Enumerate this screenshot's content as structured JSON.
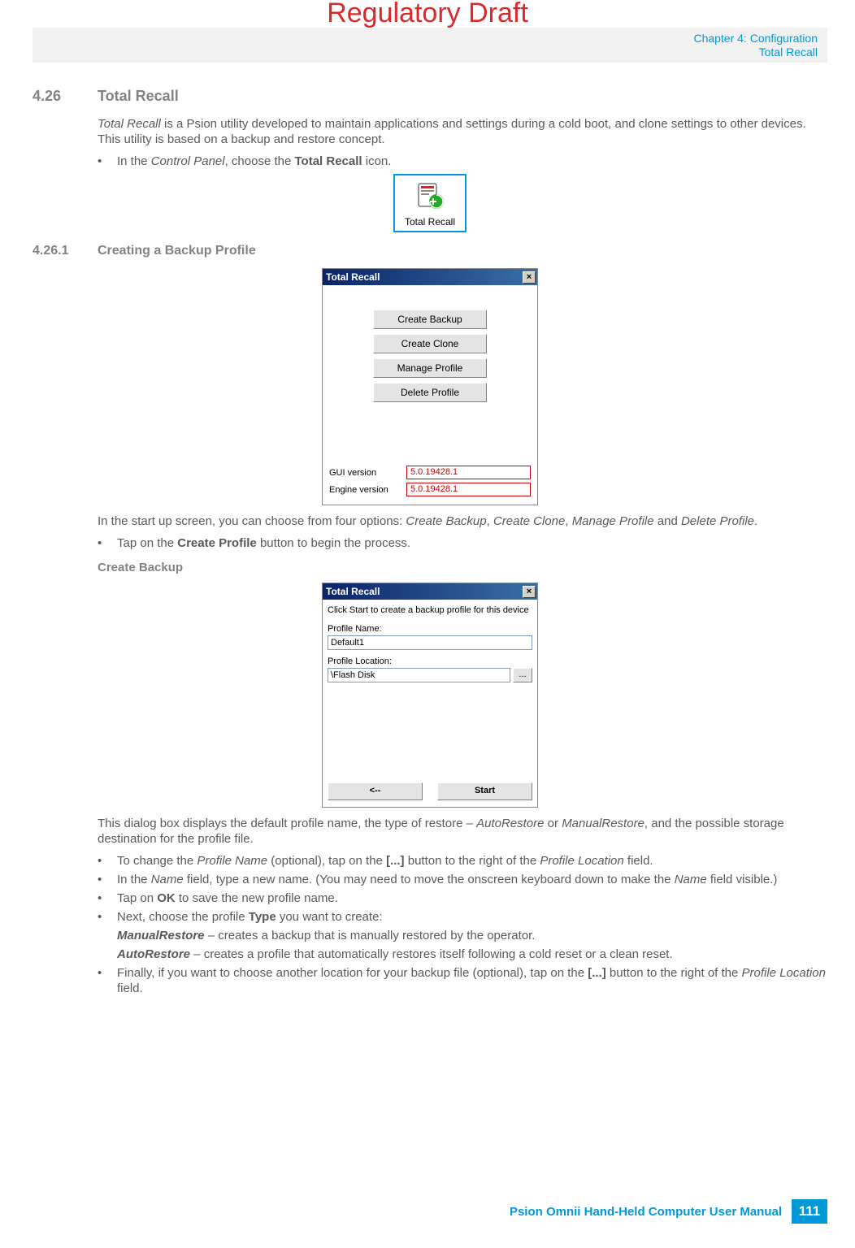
{
  "watermark": "Regulatory Draft",
  "header": {
    "chapter": "Chapter 4:  Configuration",
    "section": "Total Recall"
  },
  "s426": {
    "num": "4.26",
    "title": "Total Recall",
    "intro_a": "Total Recall",
    "intro_b": " is a Psion utility developed to maintain applications and settings during a cold boot, and clone settings to other devices. This utility is based on a backup and restore concept.",
    "b1a": "In the ",
    "b1b": "Control Panel",
    "b1c": ", choose the ",
    "b1d": "Total Recall",
    "b1e": " icon."
  },
  "iconfig": {
    "label": "Total Recall"
  },
  "s4261": {
    "num": "4.26.1",
    "title": "Creating a Backup Profile"
  },
  "dialog1": {
    "title": "Total Recall",
    "btn1": "Create Backup",
    "btn2": "Create Clone",
    "btn3": "Manage Profile",
    "btn4": "Delete Profile",
    "gui_lab": "GUI version",
    "gui_val": "5.0.19428.1",
    "eng_lab": "Engine version",
    "eng_val": "5.0.19428.1"
  },
  "afterD1": {
    "p1a": "In the start up screen, you can choose from four options: ",
    "p1b": "Create Backup",
    "p1c": ", ",
    "p1d": "Create Clone",
    "p1e": ", ",
    "p1f": "Manage Profile",
    "p1g": " and ",
    "p1h": "Delete Profile",
    "p1i": ".",
    "b1a": "Tap on the ",
    "b1b": "Create Profile",
    "b1c": " button to begin the process."
  },
  "createBackupHead": "Create Backup",
  "dialog2": {
    "title": "Total Recall",
    "msg": "Click Start to create a backup profile for this device",
    "pname_lab": "Profile Name:",
    "pname_val": "Default1",
    "ploc_lab": "Profile Location:",
    "ploc_val": "\\Flash Disk",
    "browse": "...",
    "back": "<--",
    "start": "Start"
  },
  "afterD2": {
    "p1a": "This dialog box displays the default profile name, the type of restore – ",
    "p1b": "AutoRestore",
    "p1c": " or ",
    "p1d": "ManualRestore",
    "p1e": ", and the possible storage destination for the profile file.",
    "b1a": "To change the ",
    "b1b": "Profile Name",
    "b1c": " (optional), tap on the ",
    "b1d": "[...]",
    "b1e": " button to the right of the ",
    "b1f": "Profile Location",
    "b1g": " field.",
    "b2a": "In the ",
    "b2b": "Name",
    "b2c": " field, type a new name. (You may need to move the onscreen keyboard down to make the ",
    "b2d": "Name",
    "b2e": " field visible.)",
    "b3a": "Tap on ",
    "b3b": "OK",
    "b3c": " to save the new profile name.",
    "b4a": "Next, choose the profile ",
    "b4b": "Type",
    "b4c": " you want to create:",
    "ind1a": "ManualRestore",
    "ind1b": " – creates a backup that is manually restored by the operator.",
    "ind2a": "AutoRestore",
    "ind2b": " – creates a profile that automatically restores itself following a cold reset or a clean reset.",
    "b5a": "Finally, if you want to choose another location for your backup file (optional), tap on the ",
    "b5b": "[...]",
    "b5c": " button to the right of the ",
    "b5d": "Profile Location",
    "b5e": " field."
  },
  "footer": {
    "text": "Psion Omnii Hand-Held Computer User Manual",
    "page": "111"
  }
}
